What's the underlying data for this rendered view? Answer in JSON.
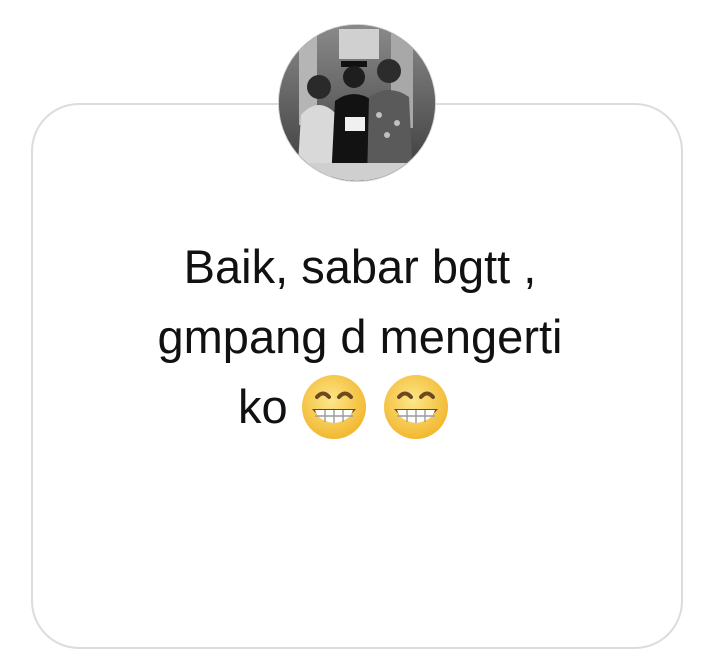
{
  "reply": {
    "line1": "Baik, sabar bgtt ,",
    "line2": "gmpang d mengerti",
    "line3": "ko",
    "emojis": [
      "grinning-face-smiling-eyes-icon",
      "grinning-face-smiling-eyes-icon"
    ]
  },
  "avatar": {
    "style": "black-and-white group photo"
  },
  "colors": {
    "card_border": "#dcdcdc",
    "text": "#111111",
    "emoji_face": "#f7c948"
  }
}
